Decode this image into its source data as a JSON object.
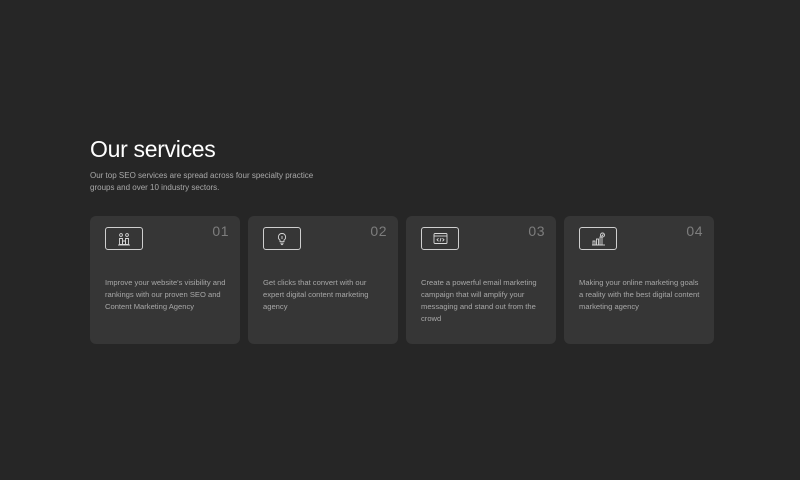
{
  "header": {
    "title_plain": "Our",
    "title_accent": "services",
    "subtitle": "Our top SEO services are spread across four specialty practice groups and over 10 industry sectors."
  },
  "colors": {
    "background": "#262626",
    "card": "#363636",
    "accent_underline": "#3a5ee6"
  },
  "cards": [
    {
      "number": "01",
      "icon": "seo-trophy-icon",
      "text": "Improve your website's visibility and rankings with our proven SEO and Content Marketing Agency"
    },
    {
      "number": "02",
      "icon": "lightbulb-icon",
      "text": "Get clicks that convert with our expert digital content marketing agency"
    },
    {
      "number": "03",
      "icon": "code-window-icon",
      "text": "Create a powerful email marketing campaign that will amplify your messaging and stand out from the crowd"
    },
    {
      "number": "04",
      "icon": "growth-chart-icon",
      "text": "Making your online marketing goals a reality with the best digital content marketing agency"
    }
  ]
}
